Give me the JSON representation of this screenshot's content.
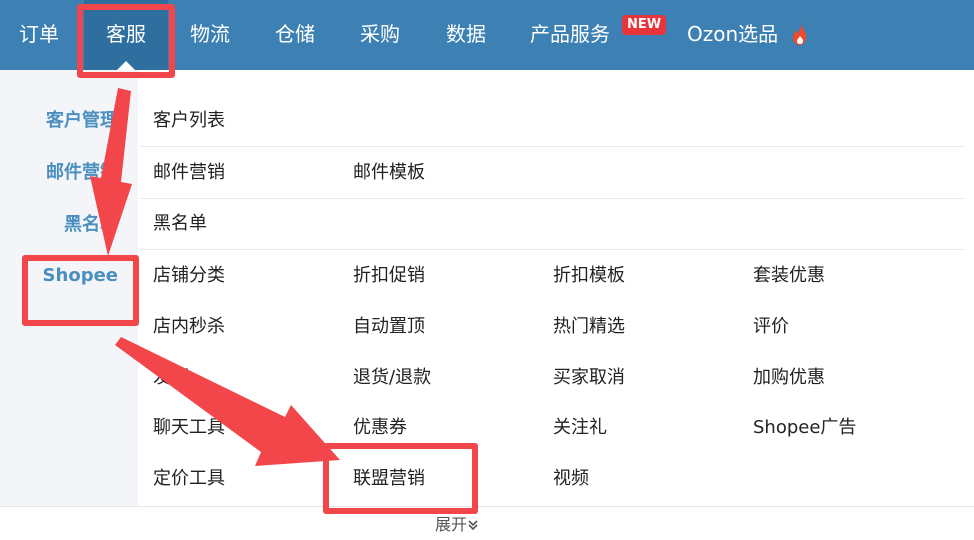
{
  "nav": {
    "items": [
      "订单",
      "客服",
      "物流",
      "仓储",
      "采购",
      "数据",
      "产品服务",
      "Ozon选品"
    ],
    "active_index": 1,
    "new_badge": "NEW"
  },
  "sidebar": {
    "categories": [
      "客户管理",
      "邮件营销",
      "黑名单",
      "Shopee"
    ]
  },
  "menu": {
    "customer": [
      "客户列表"
    ],
    "email": [
      "邮件营销",
      "邮件模板"
    ],
    "blacklist": [
      "黑名单"
    ],
    "shopee": [
      [
        "店铺分类",
        "折扣促销",
        "折扣模板",
        "套装优惠"
      ],
      [
        "店内秒杀",
        "自动置顶",
        "热门精选",
        "评价"
      ],
      [
        "发票",
        "退货/退款",
        "买家取消",
        "加购优惠"
      ],
      [
        "聊天工具",
        "优惠券",
        "关注礼",
        "Shopee广告"
      ],
      [
        "定价工具",
        "联盟营销",
        "视频"
      ]
    ]
  },
  "footer": {
    "expand_label": "展开"
  },
  "colors": {
    "nav_bg": "#3d80b3",
    "nav_active": "#2f6f9f",
    "accent": "#4a8fbf",
    "annotation": "#f2464b",
    "badge": "#e8343b"
  },
  "icons": {
    "hot": "flame-icon",
    "expand": "double-chevron-down-icon"
  }
}
